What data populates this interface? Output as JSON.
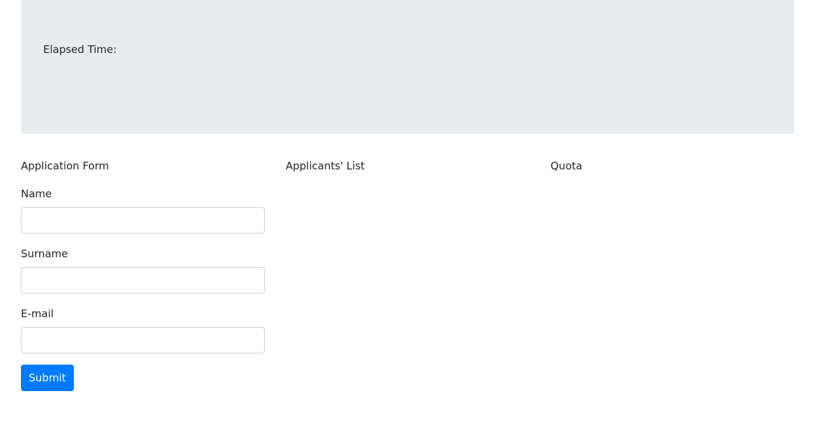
{
  "header": {
    "elapsed_label": "Elapsed Time:"
  },
  "form": {
    "heading": "Application Form",
    "name_label": "Name",
    "name_value": "",
    "surname_label": "Surname",
    "surname_value": "",
    "email_label": "E-mail",
    "email_value": "",
    "submit_label": "Submit"
  },
  "applicants": {
    "heading": "Applicants' List"
  },
  "quota": {
    "heading": "Quota"
  },
  "colors": {
    "panel_bg": "#e9ecef",
    "primary": "#007bff",
    "text": "#212529",
    "input_border": "#ced4da"
  }
}
